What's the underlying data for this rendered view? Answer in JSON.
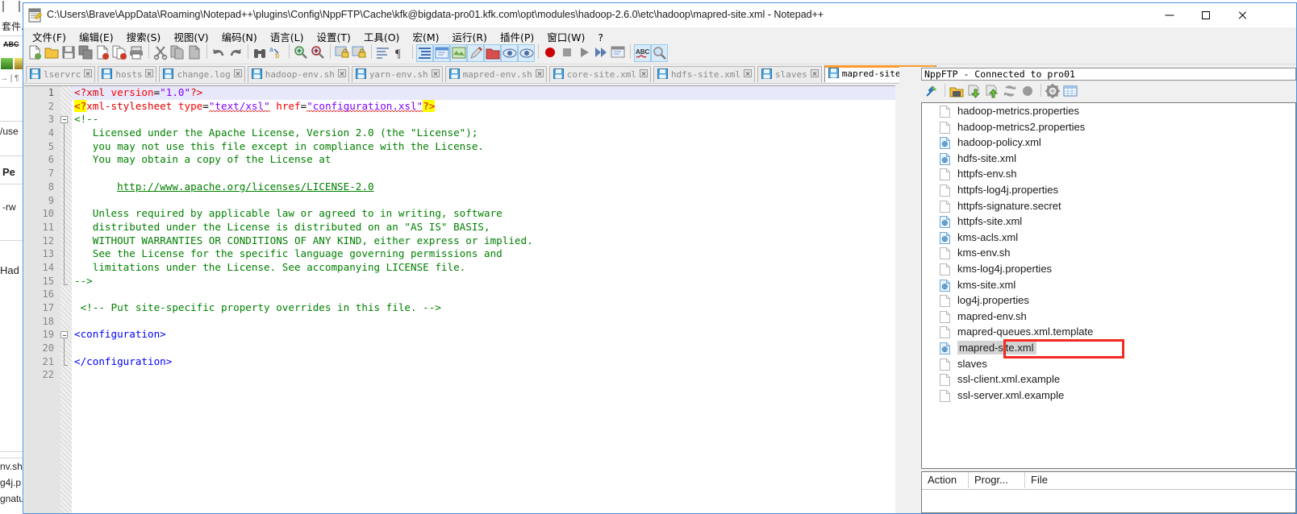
{
  "background_window": {
    "fragments": [
      "套件.",
      "ABC",
      "/use",
      "Pe",
      "-rw",
      "Had",
      "nv.sh",
      "g4j.p",
      "gnatu"
    ]
  },
  "window": {
    "title": "C:\\Users\\Brave\\AppData\\Roaming\\Notepad++\\plugins\\Config\\NppFTP\\Cache\\kfk@bigdata-pro01.kfk.com\\opt\\modules\\hadoop-2.6.0\\etc\\hadoop\\mapred-site.xml - Notepad++",
    "icon": "notepad-plus-plus-icon",
    "controls": {
      "minimize": "minimize-button",
      "maximize": "maximize-button",
      "close": "close-button"
    }
  },
  "menu": {
    "items": [
      "文件(F)",
      "编辑(E)",
      "搜索(S)",
      "视图(V)",
      "编码(N)",
      "语言(L)",
      "设置(T)",
      "工具(O)",
      "宏(M)",
      "运行(R)",
      "插件(P)",
      "窗口(W)",
      "?"
    ]
  },
  "toolbar": {
    "buttons": [
      "new-file-icon",
      "open-file-icon",
      "save-icon",
      "save-all-icon",
      "close-file-icon",
      "close-all-icon",
      "print-icon",
      "sep",
      "cut-icon",
      "copy-icon",
      "paste-icon",
      "sep",
      "undo-icon",
      "redo-icon",
      "sep",
      "find-icon",
      "replace-icon",
      "sep",
      "zoom-in-icon",
      "zoom-out-icon",
      "sep",
      "sync-vertical-icon",
      "sync-horizontal-icon",
      "sep",
      "word-wrap-icon",
      "show-all-chars-icon",
      "sep",
      "indent-guide-icon",
      "user-defined-dialog-icon",
      "show-symbol-icon",
      "doc-map-icon",
      "function-list-icon",
      "folder-as-workspace-icon",
      "monitoring-icon",
      "sep",
      "record-macro-icon",
      "stop-macro-icon",
      "play-macro-icon",
      "fast-playback-icon",
      "save-macro-icon",
      "sep",
      "spellcheck-icon",
      "search-web-icon"
    ]
  },
  "tabs": [
    {
      "label": "lservrc",
      "active": false
    },
    {
      "label": "hosts",
      "active": false
    },
    {
      "label": "change.log",
      "active": false
    },
    {
      "label": "hadoop-env.sh",
      "active": false
    },
    {
      "label": "yarn-env.sh",
      "active": false
    },
    {
      "label": "mapred-env.sh",
      "active": false
    },
    {
      "label": "core-site.xml",
      "active": false
    },
    {
      "label": "hdfs-site.xml",
      "active": false
    },
    {
      "label": "slaves",
      "active": false
    },
    {
      "label": "mapred-site.xml",
      "active": true
    }
  ],
  "editor": {
    "current_line": 1,
    "lines": [
      {
        "n": 1,
        "tokens": [
          {
            "t": "<?xml ",
            "c": "pi"
          },
          {
            "t": "version",
            "c": "attr"
          },
          {
            "t": "=",
            "c": "plain"
          },
          {
            "t": "\"1.0\"",
            "c": "val"
          },
          {
            "t": "?>",
            "c": "pi"
          }
        ]
      },
      {
        "n": 2,
        "tokens": [
          {
            "t": "<?",
            "c": "hl"
          },
          {
            "t": "xml-stylesheet ",
            "c": "pi"
          },
          {
            "t": "type",
            "c": "attr"
          },
          {
            "t": "=",
            "c": "plain"
          },
          {
            "t": "\"text/xsl\"",
            "c": "val-sq"
          },
          {
            "t": " ",
            "c": "plain"
          },
          {
            "t": "href",
            "c": "attr"
          },
          {
            "t": "=",
            "c": "plain"
          },
          {
            "t": "\"configuration.xsl\"",
            "c": "val-sq2"
          },
          {
            "t": "?>",
            "c": "hl"
          }
        ]
      },
      {
        "n": 3,
        "tokens": [
          {
            "t": "<!--",
            "c": "cmt"
          }
        ],
        "fold": "start"
      },
      {
        "n": 4,
        "tokens": [
          {
            "t": "   Licensed under the Apache License, Version 2.0 (the \"License\");",
            "c": "cmt"
          }
        ]
      },
      {
        "n": 5,
        "tokens": [
          {
            "t": "   you may not use this file except in compliance with the License.",
            "c": "cmt"
          }
        ]
      },
      {
        "n": 6,
        "tokens": [
          {
            "t": "   You may obtain a copy of the License at",
            "c": "cmt"
          }
        ]
      },
      {
        "n": 7,
        "tokens": [
          {
            "t": "",
            "c": "cmt"
          }
        ]
      },
      {
        "n": 8,
        "tokens": [
          {
            "t": "       ",
            "c": "cmt"
          },
          {
            "t": "http://www.apache.org/licenses/LICENSE-2.0",
            "c": "link"
          }
        ]
      },
      {
        "n": 9,
        "tokens": [
          {
            "t": "",
            "c": "cmt"
          }
        ]
      },
      {
        "n": 10,
        "tokens": [
          {
            "t": "   Unless required by applicable law or agreed to in writing, software",
            "c": "cmt"
          }
        ]
      },
      {
        "n": 11,
        "tokens": [
          {
            "t": "   distributed under the License is distributed on an \"AS IS\" BASIS,",
            "c": "cmt"
          }
        ]
      },
      {
        "n": 12,
        "tokens": [
          {
            "t": "   WITHOUT WARRANTIES OR CONDITIONS OF ANY KIND, either express or implied.",
            "c": "cmt"
          }
        ]
      },
      {
        "n": 13,
        "tokens": [
          {
            "t": "   See the License for the specific language governing permissions and",
            "c": "cmt"
          }
        ]
      },
      {
        "n": 14,
        "tokens": [
          {
            "t": "   limitations under the License. See accompanying LICENSE file.",
            "c": "cmt"
          }
        ]
      },
      {
        "n": 15,
        "tokens": [
          {
            "t": "-->",
            "c": "cmt"
          }
        ],
        "fold": "end"
      },
      {
        "n": 16,
        "tokens": [
          {
            "t": "",
            "c": "plain"
          }
        ]
      },
      {
        "n": 17,
        "tokens": [
          {
            "t": " <!-- Put site-specific property overrides in this file. -->",
            "c": "cmt"
          }
        ]
      },
      {
        "n": 18,
        "tokens": [
          {
            "t": "",
            "c": "plain"
          }
        ]
      },
      {
        "n": 19,
        "tokens": [
          {
            "t": "<configuration>",
            "c": "tag"
          }
        ],
        "fold": "start"
      },
      {
        "n": 20,
        "tokens": [
          {
            "t": "",
            "c": "plain"
          }
        ]
      },
      {
        "n": 21,
        "tokens": [
          {
            "t": "</configuration>",
            "c": "tag"
          }
        ],
        "fold": "end"
      },
      {
        "n": 22,
        "tokens": [
          {
            "t": "",
            "c": "plain"
          }
        ]
      }
    ]
  },
  "ftp_panel": {
    "title": "NppFTP - Connected to pro01",
    "toolbar": [
      "connect-icon",
      "sep",
      "open-directory-icon",
      "download-icon",
      "upload-icon",
      "refresh-icon",
      "abort-icon",
      "sep",
      "settings-icon",
      "messages-icon"
    ],
    "files": [
      {
        "name": "hadoop-metrics.properties",
        "type": "file",
        "selected": false
      },
      {
        "name": "hadoop-metrics2.properties",
        "type": "file",
        "selected": false
      },
      {
        "name": "hadoop-policy.xml",
        "type": "xml",
        "selected": false
      },
      {
        "name": "hdfs-site.xml",
        "type": "xml",
        "selected": false
      },
      {
        "name": "httpfs-env.sh",
        "type": "file",
        "selected": false
      },
      {
        "name": "httpfs-log4j.properties",
        "type": "file",
        "selected": false
      },
      {
        "name": "httpfs-signature.secret",
        "type": "file",
        "selected": false
      },
      {
        "name": "httpfs-site.xml",
        "type": "xml",
        "selected": false
      },
      {
        "name": "kms-acls.xml",
        "type": "xml",
        "selected": false
      },
      {
        "name": "kms-env.sh",
        "type": "file",
        "selected": false
      },
      {
        "name": "kms-log4j.properties",
        "type": "file",
        "selected": false
      },
      {
        "name": "kms-site.xml",
        "type": "xml",
        "selected": false
      },
      {
        "name": "log4j.properties",
        "type": "file",
        "selected": false
      },
      {
        "name": "mapred-env.sh",
        "type": "file",
        "selected": false
      },
      {
        "name": "mapred-queues.xml.template",
        "type": "file",
        "selected": false
      },
      {
        "name": "mapred-site.xml",
        "type": "xml",
        "selected": true
      },
      {
        "name": "slaves",
        "type": "file",
        "selected": false
      },
      {
        "name": "ssl-client.xml.example",
        "type": "file",
        "selected": false
      },
      {
        "name": "ssl-server.xml.example",
        "type": "file",
        "selected": false
      }
    ],
    "queue_columns": [
      "Action",
      "Progr...",
      "File"
    ]
  },
  "annotation": {
    "color": "#f22a20",
    "target": "mapred-site.xml"
  }
}
